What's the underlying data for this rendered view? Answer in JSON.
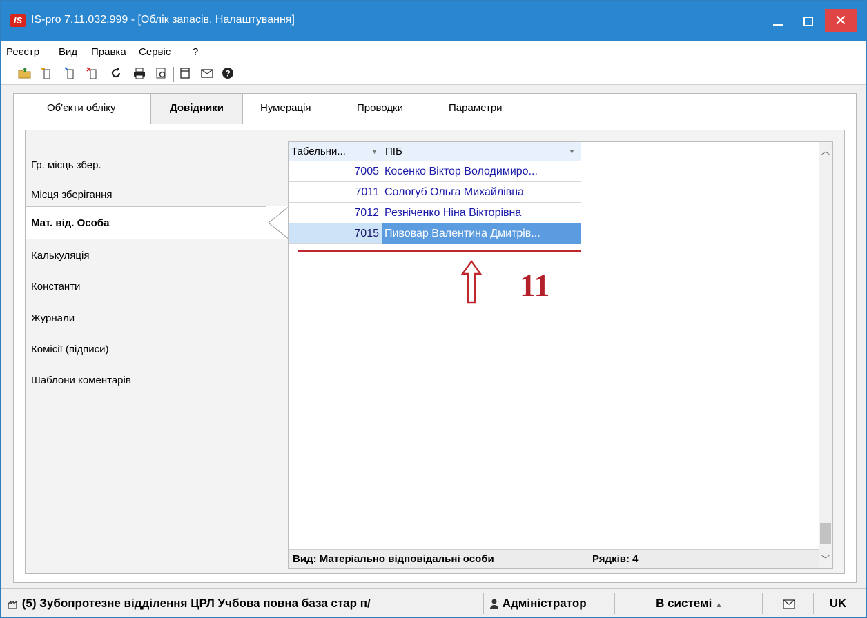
{
  "window": {
    "app_icon_text": "IS",
    "title": "IS-pro 7.11.032.999 - [Облік запасів. Налаштування]",
    "close_glyph": "✕"
  },
  "menu": [
    "Реєстр",
    "Вид",
    "Правка",
    "Сервіс",
    "?"
  ],
  "toolbar": {
    "icons": [
      "open-folder-icon",
      "new-doc-icon",
      "edit-doc-icon",
      "delete-doc-icon",
      "refresh-icon",
      "print-icon",
      "preview-icon",
      "document-icon",
      "mail-icon",
      "help-icon"
    ]
  },
  "tabs": [
    {
      "label": "Об'єкти обліку",
      "active": false
    },
    {
      "label": "Довідники",
      "active": true
    },
    {
      "label": "Нумерація",
      "active": false
    },
    {
      "label": "Проводки",
      "active": false
    },
    {
      "label": "Параметри",
      "active": false
    }
  ],
  "nav": [
    {
      "label": "Гр. місць збер."
    },
    {
      "label": "Місця зберігання"
    },
    {
      "label": "Мат. від. Особа",
      "active": true
    },
    {
      "label": "Калькуляція"
    },
    {
      "label": "Константи"
    },
    {
      "label": "Журнали"
    },
    {
      "label": "Комісії (підписи)"
    },
    {
      "label": "Шаблони коментарів"
    }
  ],
  "grid": {
    "columns": [
      "Табельни...",
      "ПІБ"
    ],
    "rows": [
      {
        "id": "7005",
        "name": "Косенко Віктор Володимиро..."
      },
      {
        "id": "7011",
        "name": "Сологуб Ольга Михайлівна"
      },
      {
        "id": "7012",
        "name": "Резніченко Ніна Вікторівна"
      },
      {
        "id": "7015",
        "name": "Пивовар Валентина Дмитрів...",
        "selected": true
      }
    ],
    "footer_view": "Вид: Матеріально відповідальні особи",
    "footer_rows": "Рядків: 4"
  },
  "annotation": {
    "number": "11",
    "color": "#b3202a"
  },
  "statusbar": {
    "org": "(5) Зубопротезне відділення ЦРЛ Учбова повна база стар п/",
    "user": "Адміністратор",
    "status": "В системі",
    "lang": "UK"
  }
}
